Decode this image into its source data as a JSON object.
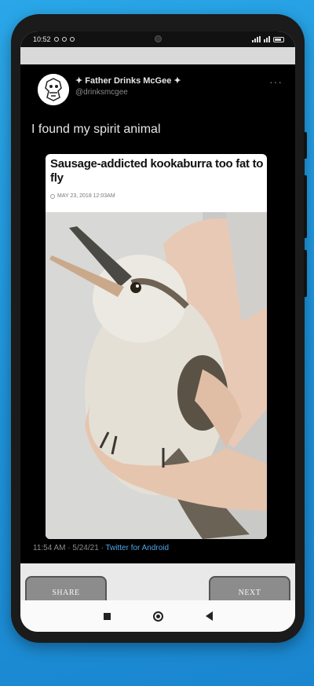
{
  "status_bar": {
    "time": "10:52"
  },
  "tweet": {
    "display_name": "✦ Father Drinks McGee ✦",
    "handle": "@drinksmcgee",
    "more_icon": "···",
    "text": "I found my spirit animal",
    "card": {
      "title": "Sausage-addicted kookaburra too fat to fly",
      "meta": "MAY 23, 2018 12:03AM"
    },
    "timestamp": "11:54 AM · 5/24/21 ·",
    "source": "Twitter for Android"
  },
  "controls": {
    "share_label": "SHARE",
    "next_label": "NEXT"
  },
  "icons": {
    "home": "home-icon",
    "recents": "recents-icon",
    "back": "back-icon"
  },
  "colors": {
    "background": "#1e92d9",
    "link": "#4ea6e8",
    "button": "#8c8c8c"
  }
}
